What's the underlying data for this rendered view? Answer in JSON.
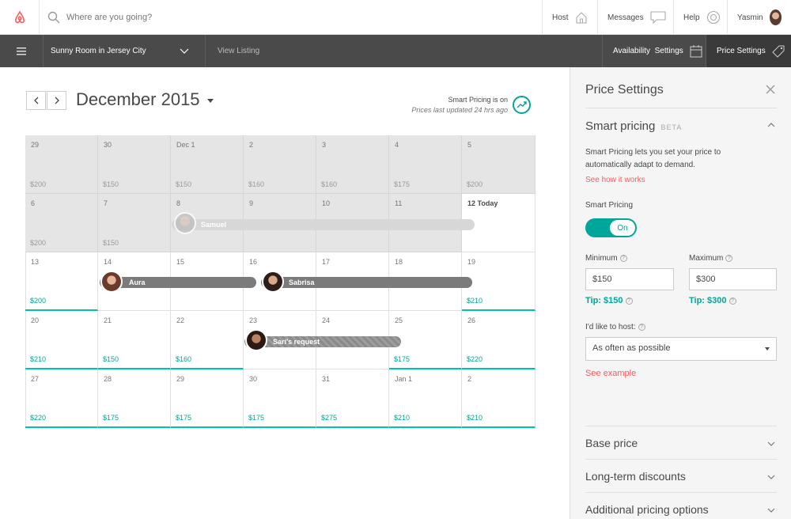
{
  "header": {
    "search_placeholder": "Where are you going?",
    "nav": [
      {
        "label": "Host"
      },
      {
        "label": "Messages"
      },
      {
        "label": "Help"
      },
      {
        "label": "Yasmin"
      }
    ]
  },
  "subbar": {
    "listing_title": "Sunny Room in Jersey City",
    "view_listing": "View Listing",
    "availability_settings": "Availability  Settings",
    "price_settings": "Price Settings"
  },
  "calendar": {
    "month_title": "December 2015",
    "smart_pricing_note": "Smart Pricing is on",
    "last_updated": "Prices last updated 24 hrs ago",
    "weeks": [
      [
        {
          "d": "29",
          "p": "$200",
          "past": true
        },
        {
          "d": "30",
          "p": "$150",
          "past": true
        },
        {
          "d": "Dec 1",
          "p": "$150",
          "past": true
        },
        {
          "d": "2",
          "p": "$160",
          "past": true
        },
        {
          "d": "3",
          "p": "$160",
          "past": true
        },
        {
          "d": "4",
          "p": "$175",
          "past": true
        },
        {
          "d": "5",
          "p": "$200",
          "past": true
        }
      ],
      [
        {
          "d": "6",
          "p": "$200",
          "past": true
        },
        {
          "d": "7",
          "p": "$150",
          "past": true
        },
        {
          "d": "8",
          "p": "",
          "past": true
        },
        {
          "d": "9",
          "p": "",
          "past": true
        },
        {
          "d": "10",
          "p": "",
          "past": true
        },
        {
          "d": "11",
          "p": "",
          "past": true
        },
        {
          "d": "12 Today",
          "p": "",
          "today": true
        }
      ],
      [
        {
          "d": "13",
          "p": "$200",
          "teal": true
        },
        {
          "d": "14",
          "p": ""
        },
        {
          "d": "15",
          "p": ""
        },
        {
          "d": "16",
          "p": ""
        },
        {
          "d": "17",
          "p": ""
        },
        {
          "d": "18",
          "p": ""
        },
        {
          "d": "19",
          "p": "$210",
          "teal": true
        }
      ],
      [
        {
          "d": "20",
          "p": "$210",
          "teal": true
        },
        {
          "d": "21",
          "p": "$150",
          "teal": true
        },
        {
          "d": "22",
          "p": "$160",
          "teal": true
        },
        {
          "d": "23",
          "p": ""
        },
        {
          "d": "24",
          "p": ""
        },
        {
          "d": "25",
          "p": "$175",
          "teal": true
        },
        {
          "d": "26",
          "p": "$220",
          "teal": true
        }
      ],
      [
        {
          "d": "27",
          "p": "$220",
          "teal": true
        },
        {
          "d": "28",
          "p": "$175",
          "teal": true
        },
        {
          "d": "29",
          "p": "$175",
          "teal": true
        },
        {
          "d": "30",
          "p": "$175",
          "teal": true
        },
        {
          "d": "31",
          "p": "$275",
          "teal": true
        },
        {
          "d": "Jan 1",
          "p": "$210",
          "teal": true
        },
        {
          "d": "2",
          "p": "$210",
          "teal": true
        }
      ]
    ],
    "reservations": [
      {
        "name": "Samuel"
      },
      {
        "name": "Aura"
      },
      {
        "name": "Sabrisa"
      },
      {
        "name": "Sari's request"
      }
    ]
  },
  "panel": {
    "title": "Price Settings",
    "smart_pricing_heading": "Smart pricing",
    "beta": "BETA",
    "description": "Smart Pricing lets you set your price to automatically adapt to demand.",
    "see_how": "See how it works",
    "smart_pricing_label": "Smart Pricing",
    "toggle_state": "On",
    "minimum_label": "Minimum",
    "maximum_label": "Maximum",
    "minimum_value": "$150",
    "maximum_value": "$300",
    "tip_min": "Tip: $150",
    "tip_max": "Tip: $300",
    "host_label": "I'd like to host:",
    "host_value": "As often as possible",
    "see_example": "See example",
    "sections": [
      "Base price",
      "Long-term discounts",
      "Additional pricing options"
    ]
  },
  "colors": {
    "brand": "#ff5a5f",
    "teal": "#00a699",
    "dark_bar": "#4a4a4a"
  }
}
